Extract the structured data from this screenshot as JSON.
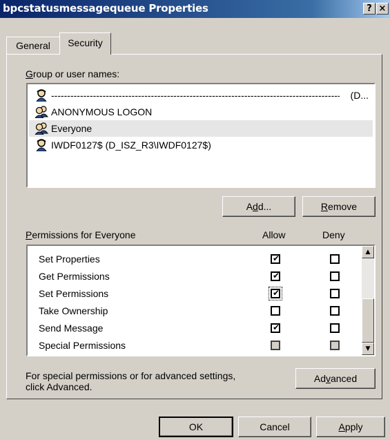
{
  "window": {
    "title": "bpcstatusmessagequeue Properties",
    "help_button": "?",
    "close_button": "×"
  },
  "tabs": [
    {
      "label": "General"
    },
    {
      "label": "Security"
    }
  ],
  "group_section": {
    "label": "Group or user names:",
    "label_mnemonic": "G",
    "label_rest": "roup or user names:",
    "users": [
      {
        "name": "-----------------------------------------------------------------------------------------------------------------------",
        "suffix": "(D...",
        "icon": "user-icon",
        "selected": false
      },
      {
        "name": "ANONYMOUS LOGON",
        "icon": "group-icon",
        "selected": false
      },
      {
        "name": "Everyone",
        "icon": "group-icon",
        "selected": true
      },
      {
        "name": "IWDF0127$ (D_ISZ_R3\\IWDF0127$)",
        "icon": "user-icon",
        "selected": false
      }
    ],
    "add_button": {
      "pre": "A",
      "mnemonic": "d",
      "post": "d..."
    },
    "remove_button": {
      "mnemonic": "R",
      "post": "emove"
    }
  },
  "permissions": {
    "label_mnemonic": "P",
    "label_rest": "ermissions for Everyone",
    "allow_header": "Allow",
    "deny_header": "Deny",
    "rows": [
      {
        "name": "Set Properties",
        "allow": true,
        "deny": false,
        "allow_disabled": false,
        "deny_disabled": false
      },
      {
        "name": "Get Permissions",
        "allow": true,
        "deny": false,
        "allow_disabled": false,
        "deny_disabled": false
      },
      {
        "name": "Set Permissions",
        "allow": true,
        "deny": false,
        "allow_disabled": false,
        "deny_disabled": false
      },
      {
        "name": "Take Ownership",
        "allow": false,
        "deny": false,
        "allow_disabled": false,
        "deny_disabled": false
      },
      {
        "name": "Send Message",
        "allow": true,
        "deny": false,
        "allow_disabled": false,
        "deny_disabled": false
      },
      {
        "name": "Special Permissions",
        "allow": false,
        "deny": false,
        "allow_disabled": true,
        "deny_disabled": true
      }
    ]
  },
  "advanced": {
    "text_line1": "For special permissions or for advanced settings,",
    "text_line2": "click Advanced.",
    "button": {
      "pre": "Ad",
      "mnemonic": "v",
      "post": "anced"
    }
  },
  "footer": {
    "ok": "OK",
    "cancel": "Cancel",
    "apply_mnemonic": "A",
    "apply_rest": "pply"
  }
}
